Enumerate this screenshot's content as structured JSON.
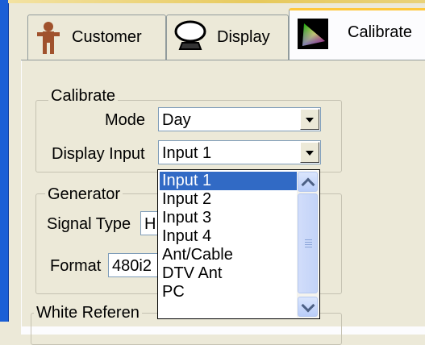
{
  "tabs": [
    {
      "label": "Customer",
      "icon": "person-icon",
      "active": false
    },
    {
      "label": "Display",
      "icon": "monitor-icon",
      "active": false
    },
    {
      "label": "Calibrate",
      "icon": "color-gamut-icon",
      "active": true
    }
  ],
  "calibrate_group": {
    "title": "Calibrate",
    "mode_label": "Mode",
    "mode_value": "Day",
    "display_input_label": "Display Input",
    "display_input_value": "Input 1"
  },
  "generator_group": {
    "title": "Generator",
    "signal_type_label": "Signal Type",
    "signal_type_value": "H",
    "format_label": "Format",
    "format_value": "480i2"
  },
  "white_reference_group": {
    "title": "White Referen"
  },
  "dropdown": {
    "items": [
      "Input 1",
      "Input 2",
      "Input 3",
      "Input 4",
      "Ant/Cable",
      "DTV Ant",
      "PC"
    ],
    "selected": "Input 1"
  },
  "colors": {
    "selection": "#316ac5",
    "window_frame": "#1a5fd6",
    "active_tab_accent": "#ffc83c"
  }
}
